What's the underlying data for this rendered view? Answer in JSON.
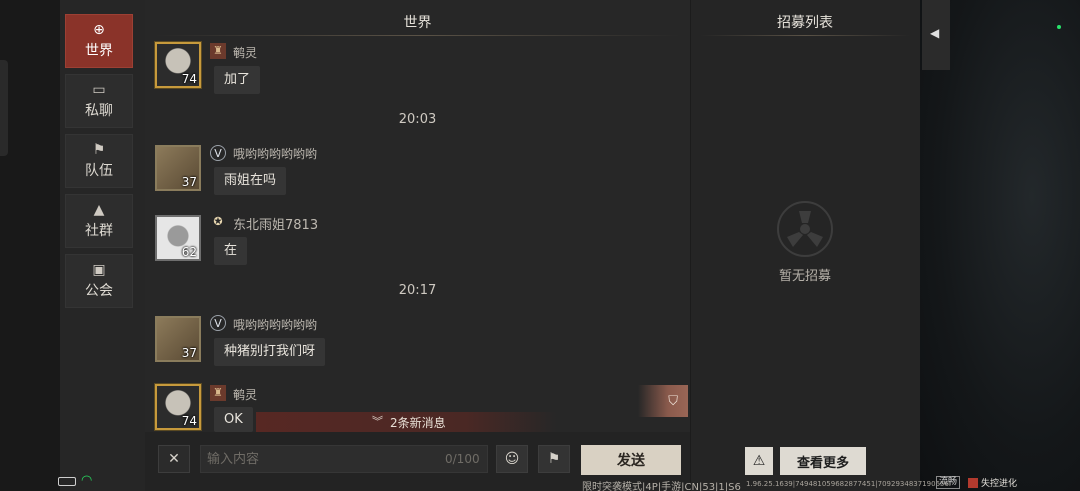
{
  "sidebar": {
    "items": [
      {
        "label": "世界",
        "icon": "globe-icon",
        "active": true
      },
      {
        "label": "私聊",
        "icon": "chat-bubbles-icon",
        "active": false
      },
      {
        "label": "队伍",
        "icon": "flag-icon",
        "active": false
      },
      {
        "label": "社群",
        "icon": "campfire-icon",
        "active": false
      },
      {
        "label": "公会",
        "icon": "banner-icon",
        "active": false
      }
    ]
  },
  "chat": {
    "title": "世界",
    "messages": [
      {
        "sender": "鹌灵",
        "level": "74",
        "text": "加了"
      },
      {
        "timestamp": "20:03"
      },
      {
        "sender": "哦哟哟哟哟哟哟",
        "level": "37",
        "text": "雨姐在吗"
      },
      {
        "sender": "东北雨姐7813",
        "level": "62",
        "text": "在"
      },
      {
        "timestamp": "20:17"
      },
      {
        "sender": "哦哟哟哟哟哟哟",
        "level": "37",
        "text": "种猪别打我们呀"
      },
      {
        "sender": "鹌灵",
        "level": "74",
        "text": "OK"
      }
    ],
    "new_messages_label": "2条新消息"
  },
  "input": {
    "placeholder": "输入内容",
    "counter": "0/100",
    "send_label": "发送"
  },
  "recruit": {
    "title": "招募列表",
    "empty_label": "暂无招募",
    "see_more_label": "查看更多"
  },
  "status": {
    "mode_text": "限时突袭模式|4P|手游|CN|53|1|S6",
    "version_text": "1.96.25.1639|749481059682877451|7092934837190656I",
    "smooth_label": "流畅",
    "logo_text": "失控进化"
  },
  "colors": {
    "active_tab": "#8a3329",
    "send_button": "#d9d1c3",
    "online_dot": "#27e36b"
  }
}
